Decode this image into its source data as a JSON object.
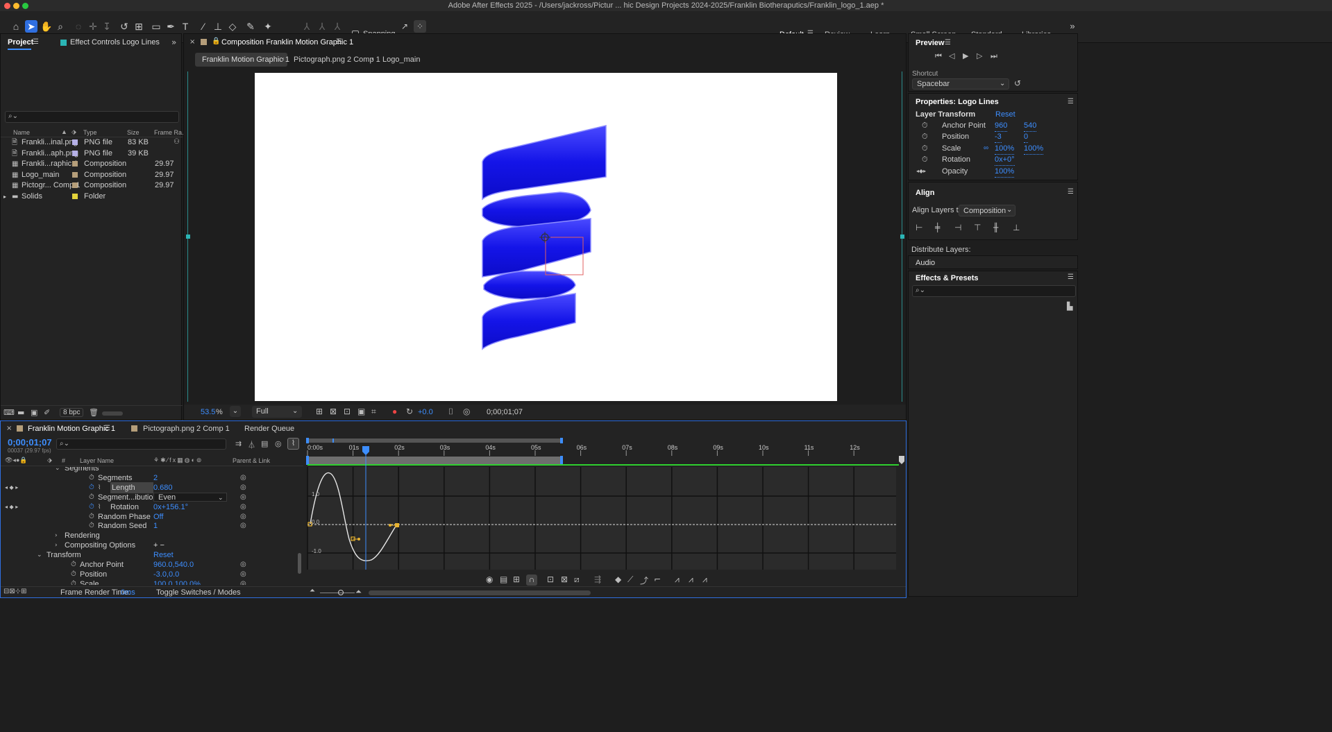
{
  "app": {
    "title": "Adobe After Effects 2025 - /Users/jackross/Pictur ... hic Design Projects 2024-2025/Franklin Biotheraputics/Franklin_logo_1.aep *"
  },
  "toolbar": {
    "snapping_label": "Snapping",
    "workspaces": [
      "Default",
      "Review",
      "Learn",
      "Small Screen",
      "Standard",
      "Libraries"
    ],
    "active_workspace": "Default"
  },
  "project_panel": {
    "tab_project": "Project",
    "tab_effect_controls": "Effect Controls Logo Lines",
    "columns": {
      "name": "Name",
      "type": "Type",
      "size": "Size",
      "frame_rate": "Frame Ra..."
    },
    "items": [
      {
        "name": "Frankli...inal.png",
        "type": "PNG file",
        "size": "83 KB",
        "fps": "",
        "color": "#b5b0e6",
        "icon": "file-icon"
      },
      {
        "name": "Frankli...aph.png",
        "type": "PNG file",
        "size": "39 KB",
        "fps": "",
        "color": "#b5b0e6",
        "icon": "file-icon"
      },
      {
        "name": "Frankli...raphic 1",
        "type": "Composition",
        "size": "",
        "fps": "29.97",
        "color": "#b59e7a",
        "icon": "composition-icon"
      },
      {
        "name": "Logo_main",
        "type": "Composition",
        "size": "",
        "fps": "29.97",
        "color": "#b59e7a",
        "icon": "composition-icon"
      },
      {
        "name": "Pictogr... Comp 1",
        "type": "Composition",
        "size": "",
        "fps": "29.97",
        "color": "#b59e7a",
        "icon": "composition-icon"
      },
      {
        "name": "Solids",
        "type": "Folder",
        "size": "",
        "fps": "",
        "color": "#e3d33a",
        "icon": "folder-icon"
      }
    ],
    "bit_depth": "8 bpc"
  },
  "composition_panel": {
    "tab_label": "Composition Franklin Motion Graphic 1",
    "breadcrumbs": [
      "Franklin Motion Graphic 1",
      "Pictograph.png 2 Comp 1",
      "Logo_main"
    ],
    "zoom": "53.5",
    "zoom_unit": "%",
    "resolution": "Full",
    "exposure": "+0.0",
    "timecode": "0;00;01;07"
  },
  "preview_panel": {
    "title": "Preview",
    "shortcut_label": "Shortcut",
    "shortcut_value": "Spacebar"
  },
  "properties_panel": {
    "title": "Properties: Logo Lines",
    "layer_transform": "Layer Transform",
    "reset": "Reset",
    "props": [
      {
        "name": "Anchor Point",
        "v1": "960",
        "v2": "540"
      },
      {
        "name": "Position",
        "v1": "-3",
        "v2": "0"
      },
      {
        "name": "Scale",
        "v1": "100",
        "v2": "100",
        "unit": "%"
      },
      {
        "name": "Rotation",
        "v1": "0x+0°",
        "v2": ""
      },
      {
        "name": "Opacity",
        "v1": "100",
        "v2": "",
        "unit": "%"
      }
    ]
  },
  "align_panel": {
    "title": "Align",
    "align_to_label": "Align Layers to:",
    "align_to_value": "Composition",
    "distribute_label": "Distribute Layers:"
  },
  "audio_panel": {
    "title": "Audio"
  },
  "effects_panel": {
    "title": "Effects & Presets"
  },
  "timeline": {
    "tabs": [
      "Franklin Motion Graphic 1",
      "Pictograph.png 2 Comp 1",
      "Render Queue"
    ],
    "timecode": "0;00;01;07",
    "frame_info": "00037 (29.97 fps)",
    "col_layer_name": "Layer Name",
    "col_parent": "Parent & Link",
    "layers": [
      {
        "label": "Segments",
        "value": "",
        "indent": 3,
        "twirl": "open"
      },
      {
        "label": "Segments",
        "value": "2",
        "indent": 4
      },
      {
        "label": "Length",
        "value": "0.680",
        "indent": 4,
        "keyframes": true,
        "selected": true
      },
      {
        "label": "Segment...ibution",
        "value": "Even",
        "indent": 4,
        "dropdown": true
      },
      {
        "label": "Rotation",
        "value": "0x+156.1°",
        "indent": 4,
        "keyframes": true
      },
      {
        "label": "Random Phase",
        "value": "Off",
        "indent": 4
      },
      {
        "label": "Random Seed",
        "value": "1",
        "indent": 4
      },
      {
        "label": "Rendering",
        "value": "",
        "indent": 3,
        "twirl": "closed"
      },
      {
        "label": "Compositing Options",
        "value": "+ −",
        "indent": 3,
        "twirl": "closed"
      },
      {
        "label": "Transform",
        "value": "Reset",
        "indent": 2,
        "twirl": "open"
      },
      {
        "label": "Anchor Point",
        "value": "960.0,540.0",
        "indent": 3
      },
      {
        "label": "Position",
        "value": "-3.0,0.0",
        "indent": 3
      },
      {
        "label": "Scale",
        "value": "100.0,100.0%",
        "indent": 3
      }
    ],
    "ruler": [
      "0:00s",
      "01s",
      "02s",
      "03s",
      "04s",
      "05s",
      "06s",
      "07s",
      "08s",
      "09s",
      "10s",
      "11s",
      "12s"
    ],
    "graph_labels": [
      "1.0",
      "0.0",
      "-1.0"
    ],
    "frame_render_label": "Frame Render Time:",
    "frame_render_value": "0ms",
    "toggle_label": "Toggle Switches / Modes"
  }
}
